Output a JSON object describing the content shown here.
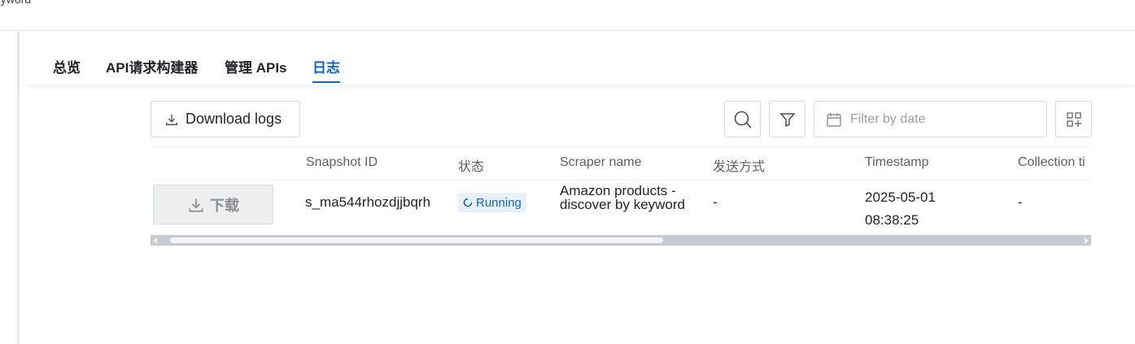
{
  "breadcrumb": {
    "text": "keyword"
  },
  "tabs": [
    {
      "label": "总览",
      "active": false
    },
    {
      "label": "API请求构建器",
      "active": false
    },
    {
      "label": "管理 APIs",
      "active": false
    },
    {
      "label": "日志",
      "active": true
    }
  ],
  "toolbar": {
    "download_logs_label": "Download logs",
    "date_filter_placeholder": "Filter by date",
    "icons": [
      "download-icon",
      "search-icon",
      "filter-icon",
      "calendar-icon",
      "column-settings-icon"
    ]
  },
  "table": {
    "columns": [
      "",
      "Snapshot ID",
      "状态",
      "Scraper name",
      "发送方式",
      "Timestamp",
      "Collection ti"
    ],
    "rows": [
      {
        "download_label": "下载",
        "snapshot_id": "s_ma544rhozdjjbqrh",
        "status": "Running",
        "scraper_name": "Amazon products - discover by keyword",
        "send_method": "-",
        "timestamp_date": "2025-05-01",
        "timestamp_time": "08:38:25",
        "collection_time": "-"
      }
    ]
  },
  "colors": {
    "accent": "#1565c0",
    "status_bg": "#e8f1fb",
    "scrollbar": "#c5cbd1"
  }
}
